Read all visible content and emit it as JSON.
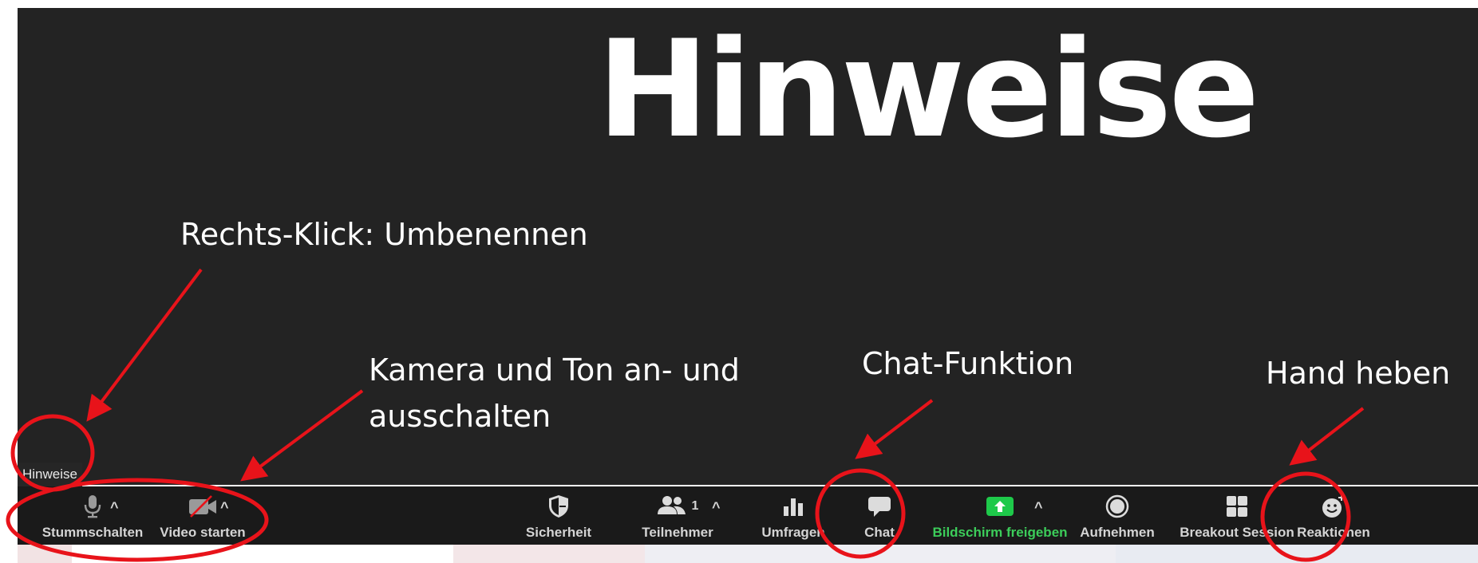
{
  "slide": {
    "title": "Hinweise"
  },
  "participant": {
    "name": "Hinweise"
  },
  "toolbar": {
    "mute_label": "Stummschalten",
    "video_label": "Video starten",
    "security_label": "Sicherheit",
    "participants_label": "Teilnehmer",
    "participants_count": "1",
    "polls_label": "Umfragen",
    "chat_label": "Chat",
    "share_label": "Bildschirm freigeben",
    "record_label": "Aufnehmen",
    "breakout_label": "Breakout Session",
    "reactions_label": "Reaktionen",
    "share_color": "#1ec94a"
  },
  "annotations": {
    "rename": "Rechts-Klick: Umbenennen",
    "camera_line1": "Kamera und Ton an- und",
    "camera_line2": "ausschalten",
    "chat": "Chat-Funktion",
    "hand": "Hand heben",
    "color": "#e8131a"
  },
  "icons": {
    "mute": "microphone-icon",
    "video": "video-off-icon",
    "security": "shield-icon",
    "participants": "people-icon",
    "polls": "bar-chart-icon",
    "chat": "chat-bubble-icon",
    "share": "share-screen-icon",
    "record": "record-icon",
    "breakout": "grid-icon",
    "reactions": "smiley-icon"
  }
}
